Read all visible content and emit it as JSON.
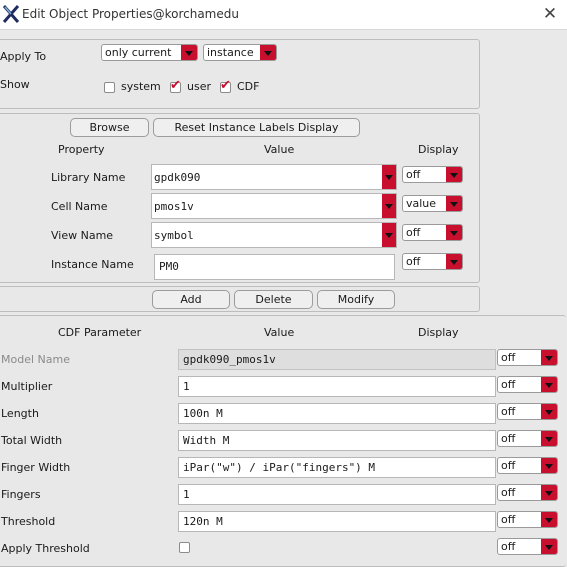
{
  "window": {
    "title": "Edit Object Properties@korchamedu"
  },
  "apply": {
    "apply_to_label": "Apply To",
    "apply_to_value": "only current",
    "apply_scope_value": "instance",
    "show_label": "Show",
    "show_options": [
      {
        "label": "system",
        "checked": false
      },
      {
        "label": "user",
        "checked": true
      },
      {
        "label": "CDF",
        "checked": true
      }
    ]
  },
  "instance": {
    "browse_label": "Browse",
    "reset_label": "Reset Instance Labels Display",
    "headers": {
      "property": "Property",
      "value": "Value",
      "display": "Display"
    },
    "rows": [
      {
        "label": "Library Name",
        "value": "gpdk090",
        "display": "off"
      },
      {
        "label": "Cell Name",
        "value": "pmos1v",
        "display": "value"
      },
      {
        "label": "View Name",
        "value": "symbol",
        "display": "off"
      },
      {
        "label": "Instance Name",
        "value": "PM0",
        "display": "off"
      }
    ],
    "add_label": "Add",
    "delete_label": "Delete",
    "modify_label": "Modify"
  },
  "cdf": {
    "headers": {
      "parameter": "CDF Parameter",
      "value": "Value",
      "display": "Display"
    },
    "rows": [
      {
        "label": "Model Name",
        "value": "gpdk090_pmos1v",
        "display": "off"
      },
      {
        "label": "Multiplier",
        "value": "1",
        "display": "off"
      },
      {
        "label": "Length",
        "value": "100n M",
        "display": "off"
      },
      {
        "label": "Total Width",
        "value": "Width M",
        "display": "off"
      },
      {
        "label": "Finger Width",
        "value": "iPar(\"w\") / iPar(\"fingers\") M",
        "display": "off"
      },
      {
        "label": "Fingers",
        "value": "1",
        "display": "off"
      },
      {
        "label": "Threshold",
        "value": "120n M",
        "display": "off"
      },
      {
        "label": "Apply Threshold",
        "value": "",
        "display": "off"
      }
    ]
  },
  "colors": {
    "accent_red": "#c8102e",
    "panel": "#e8e8e8"
  }
}
